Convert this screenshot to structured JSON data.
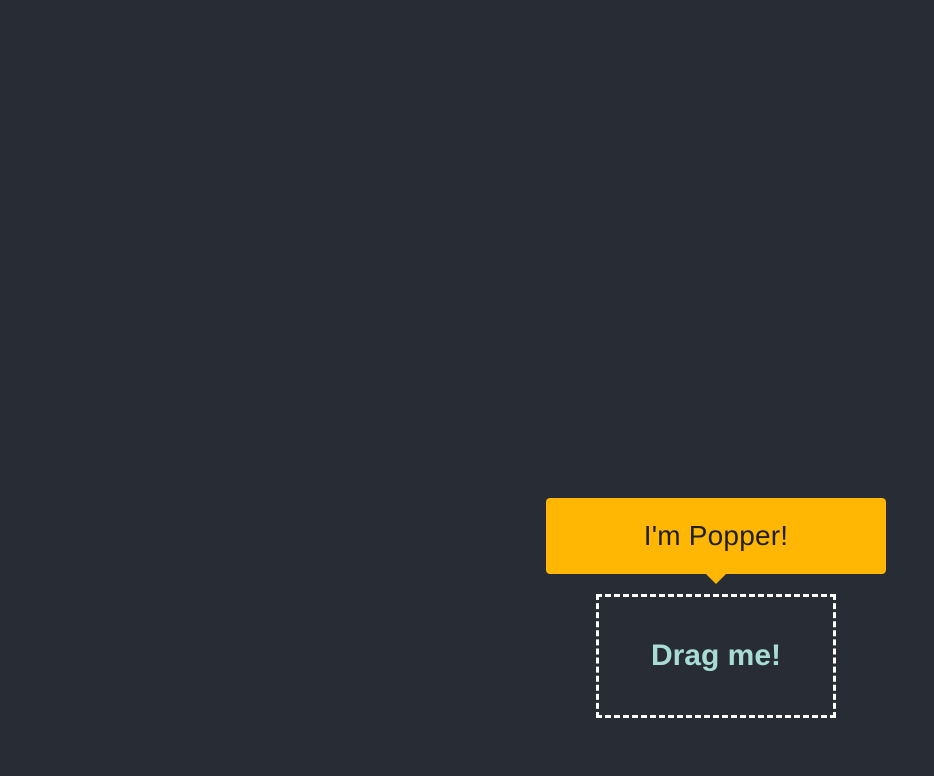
{
  "popper": {
    "text": "I'm Popper!",
    "background_color": "#ffb703",
    "text_color": "#1f1f1f"
  },
  "reference": {
    "label": "Drag me!",
    "border_color": "#ffffff",
    "text_color": "#a7dcd7"
  },
  "page": {
    "background_color": "#282d35"
  }
}
